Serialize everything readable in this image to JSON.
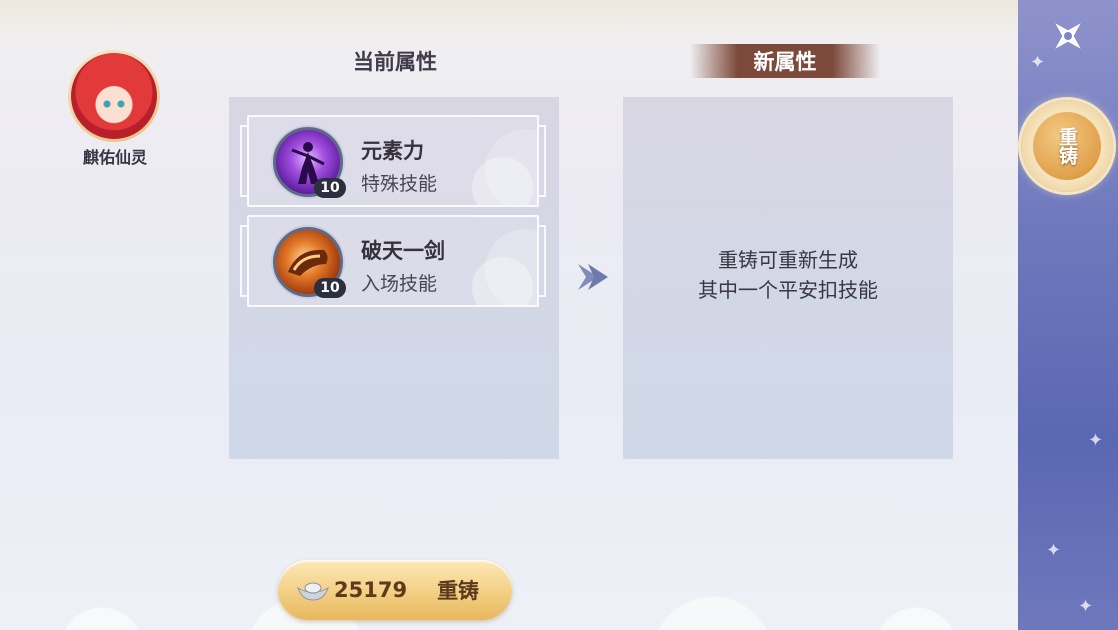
{
  "character": {
    "name": "麒佑仙灵"
  },
  "headers": {
    "current": "当前属性",
    "new": "新属性"
  },
  "current_skills": [
    {
      "name": "元素力",
      "type": "特殊技能",
      "level": "10"
    },
    {
      "name": "破天一剑",
      "type": "入场技能",
      "level": "10"
    }
  ],
  "new_panel": {
    "hint_line1": "重铸可重新生成",
    "hint_line2": "其中一个平安扣技能"
  },
  "reforge_button": {
    "cost": "25179",
    "label": "重铸"
  },
  "sidebar": {
    "tab_label": "重铸"
  },
  "colors": {
    "sidebar": "#6f79bd",
    "button_gold": "#f3cf83",
    "new_title_bg": "#7c4a3b"
  }
}
